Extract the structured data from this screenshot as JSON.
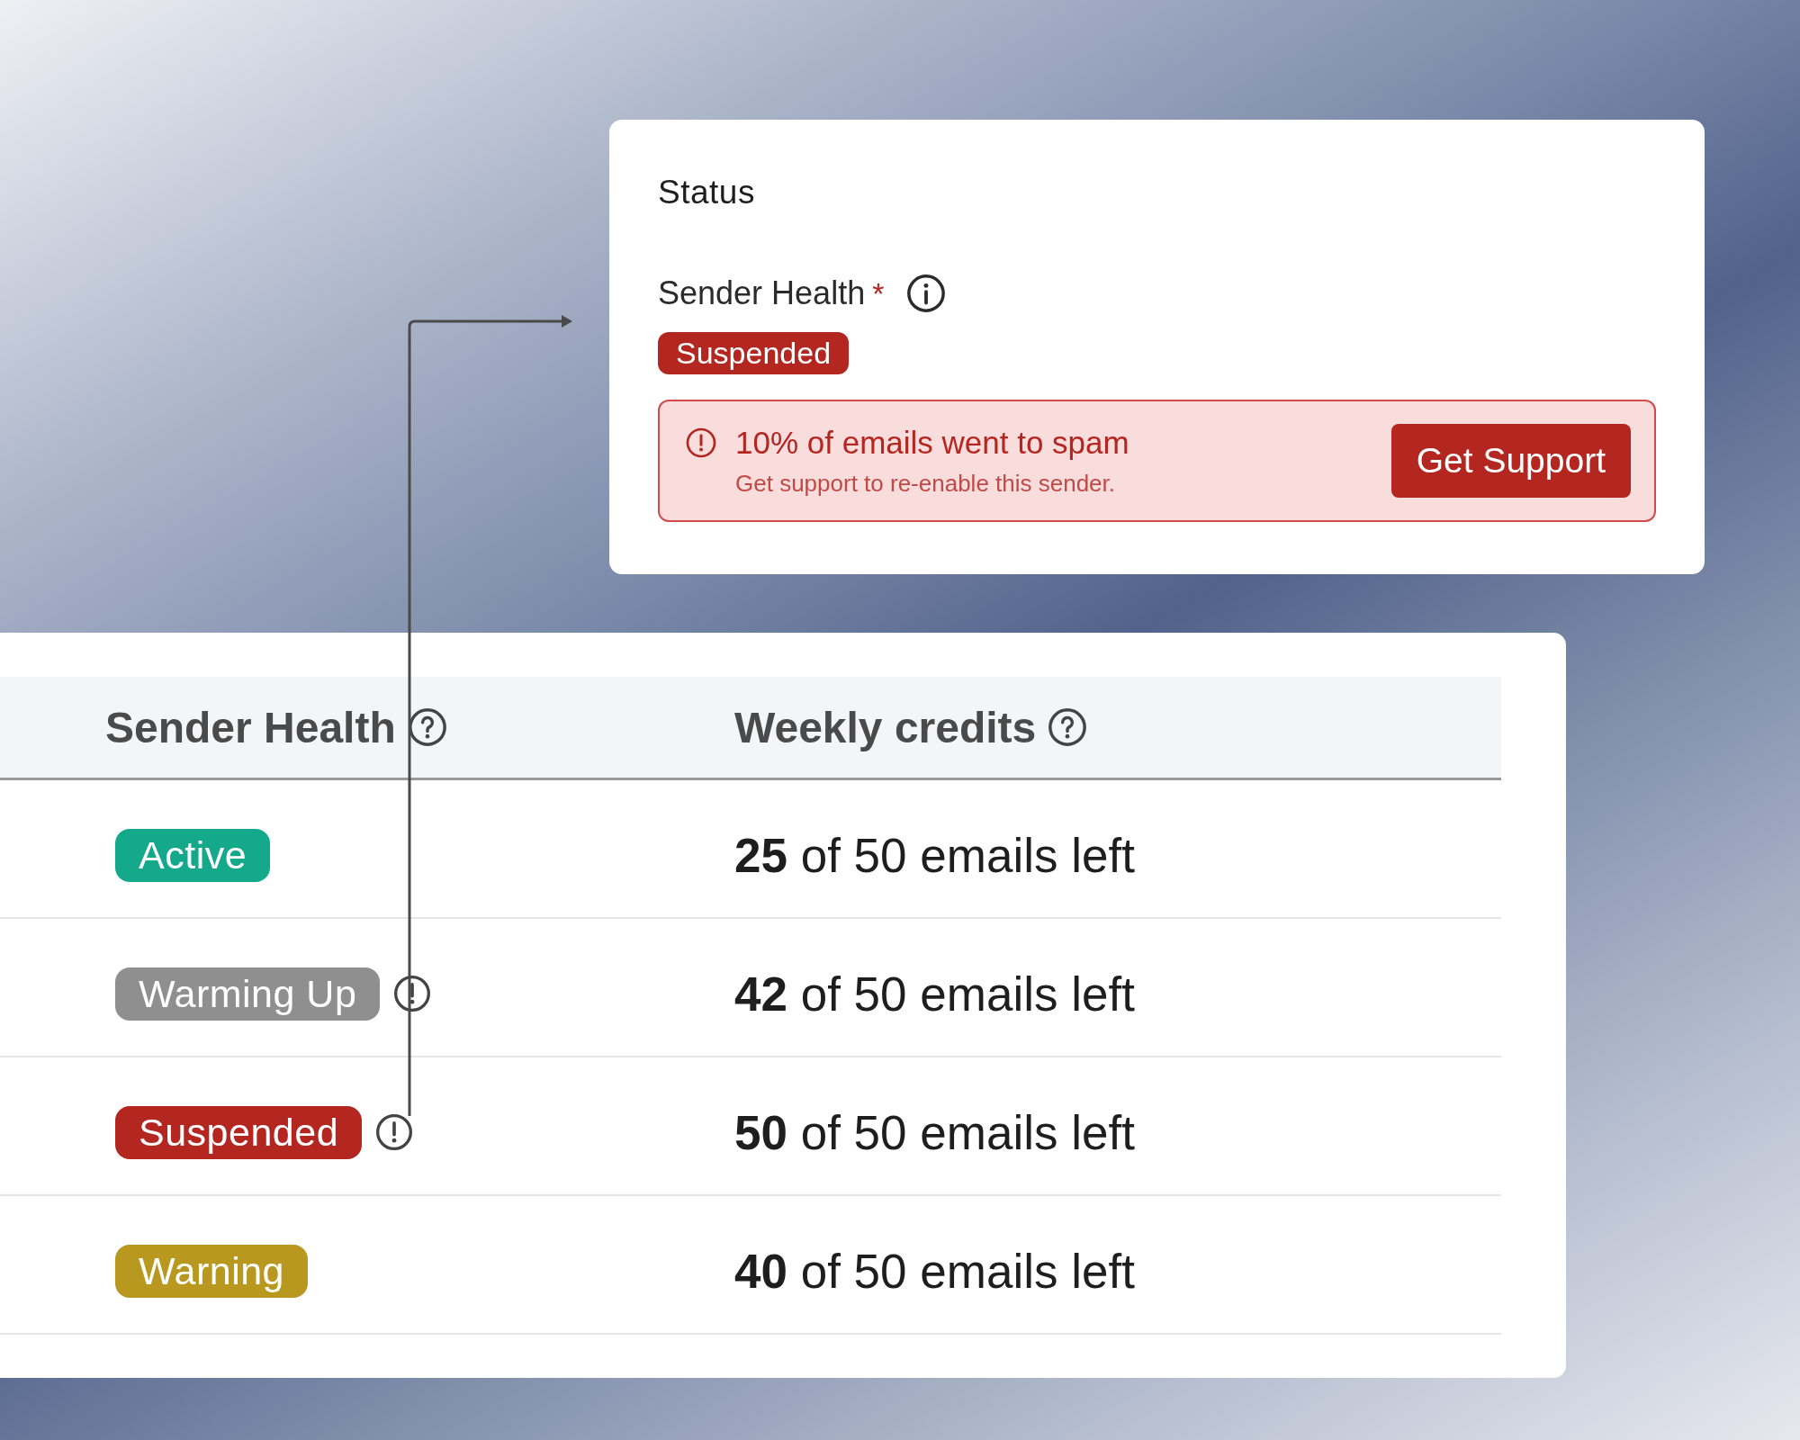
{
  "status_card": {
    "title": "Status",
    "field_label": "Sender Health",
    "required_mark": "*",
    "badge": {
      "label": "Suspended",
      "kind": "suspended"
    },
    "alert": {
      "title": "10% of emails went to spam",
      "message": "Get support to re-enable this sender.",
      "button": "Get Support"
    }
  },
  "table": {
    "columns": [
      {
        "label": "Sender Health"
      },
      {
        "label": "Weekly credits"
      }
    ],
    "rows": [
      {
        "status": {
          "label": "Active",
          "kind": "active",
          "alert_icon": false
        },
        "credits": "**25** of 50 emails left"
      },
      {
        "status": {
          "label": "Warming Up",
          "kind": "warming",
          "alert_icon": true
        },
        "credits": "**42** of 50 emails left"
      },
      {
        "status": {
          "label": "Suspended",
          "kind": "suspended",
          "alert_icon": true
        },
        "credits": "**50** of 50 emails left"
      },
      {
        "status": {
          "label": "Warning",
          "kind": "warning",
          "alert_icon": false
        },
        "credits": "**40** of 50 emails left"
      }
    ]
  }
}
